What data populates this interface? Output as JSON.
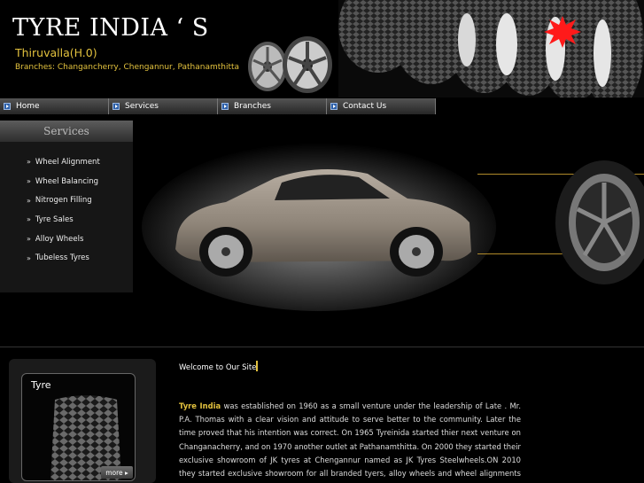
{
  "header": {
    "title": "TYRE INDIA ‘ S",
    "subtitle": "Thiruvalla(H.0)",
    "branches": "Branches: Changancherry, Chengannur, Pathanamthitta"
  },
  "nav": {
    "items": [
      {
        "label": "Home"
      },
      {
        "label": "Services"
      },
      {
        "label": "Branches"
      },
      {
        "label": "Contact Us"
      }
    ]
  },
  "services": {
    "heading": "Services",
    "bullet": "»",
    "items": [
      {
        "label": "Wheel Alignment"
      },
      {
        "label": "Wheel Balancing"
      },
      {
        "label": "Nitrogen Filling"
      },
      {
        "label": "Tyre Sales"
      },
      {
        "label": "Alloy Wheels"
      },
      {
        "label": "Tubeless Tyres"
      }
    ]
  },
  "promo": {
    "title": "Tyre",
    "more_label": "more ▸"
  },
  "content": {
    "welcome": "Welcome to Our Site",
    "brand": "Tyre India",
    "about": " was established on 1960 as a small venture under the leadership of Late . Mr. P.A. Thomas with a clear vision and attitude to serve better to the community. Later the time proved that his intention was correct. On 1965 Tyreinida started thier next venture on Changanacherry, and on 1970 another outlet at Pathanamthitta. On 2000 they started their exclusive showroom of JK tyres at Chengannur named as JK Tyres Steelwheels.ON 2010 they started exclusive showroom for all branded tyers, alloy wheels and wheel alignments center in pathanamthitta tyre indias wheels club."
  },
  "colors": {
    "accent_gold": "#e3c23e",
    "starburst": "#ff1a1a",
    "nav_icon": "#2c5fa8"
  }
}
